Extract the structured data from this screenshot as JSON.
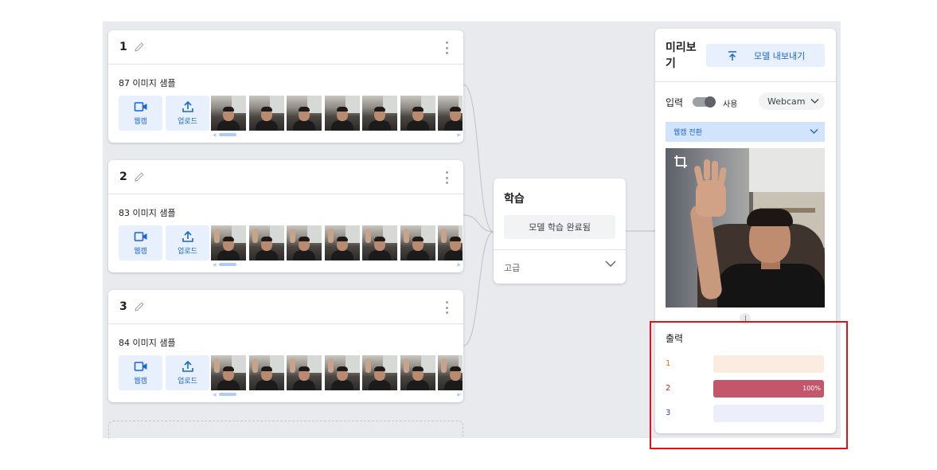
{
  "classes": [
    {
      "name": "1",
      "samples": "87 이미지 샘플",
      "webcam_label": "웹캠",
      "upload_label": "업로드",
      "raised": false
    },
    {
      "name": "2",
      "samples": "83 이미지 샘플",
      "webcam_label": "웹캠",
      "upload_label": "업로드",
      "raised": true
    },
    {
      "name": "3",
      "samples": "84 이미지 샘플",
      "webcam_label": "웹캠",
      "upload_label": "업로드",
      "raised": true
    }
  ],
  "training": {
    "title": "학습",
    "button_label": "모델 학습 완료됨",
    "advanced_label": "고급"
  },
  "preview": {
    "title": "미리보기",
    "export_label": "모델 내보내기",
    "input_label": "입력",
    "toggle_label": "사용",
    "toggle_on": true,
    "source_select": "Webcam",
    "switch_label": "웹캠 전환",
    "output_label": "출력",
    "outputs": [
      {
        "name": "1",
        "value": 0,
        "label": "",
        "color": "#e37400",
        "bg": "#fcebe0",
        "fill": "#f0a36f"
      },
      {
        "name": "2",
        "value": 1.0,
        "label": "100%",
        "color": "#c5221f",
        "bg": "#f6d8dc",
        "fill": "#c4566b"
      },
      {
        "name": "3",
        "value": 0,
        "label": "",
        "color": "#3f3fb8",
        "bg": "#eceefc",
        "fill": "#7b7fe0"
      }
    ]
  },
  "icons": {
    "edit": "pencil-icon",
    "menu": "more-vert-icon",
    "webcam": "videocam-icon",
    "upload": "upload-icon",
    "export": "publish-icon",
    "expand": "chevron-down-icon",
    "crop": "crop-icon"
  },
  "colors": {
    "accent": "#1967d2",
    "accent_bg": "#e8f0fe",
    "canvas_bg": "#e8eaed",
    "highlight": "#d9141a"
  }
}
